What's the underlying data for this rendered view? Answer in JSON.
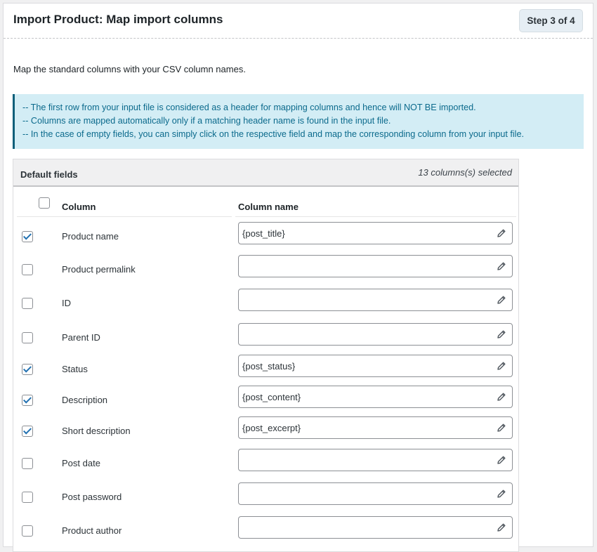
{
  "header": {
    "title": "Import Product: Map import columns",
    "step": "Step 3 of 4"
  },
  "intro": "Map the standard columns with your CSV column names.",
  "notice": {
    "lines": [
      "-- The first row from your input file is considered as a header for mapping columns and hence will NOT BE imported.",
      "-- Columns are mapped automatically only if a matching header name is found in the input file.",
      "-- In the case of empty fields, you can simply click on the respective field and map the corresponding column from your input file."
    ]
  },
  "table": {
    "section_label": "Default fields",
    "selected_count": "13 columns(s) selected",
    "columns": {
      "column": "Column",
      "column_name": "Column name"
    },
    "rows": [
      {
        "name": "Product name",
        "checked": true,
        "value": "{post_title}"
      },
      {
        "name": "Product permalink",
        "checked": false,
        "value": ""
      },
      {
        "name": "ID",
        "checked": false,
        "value": ""
      },
      {
        "name": "Parent ID",
        "checked": false,
        "value": ""
      },
      {
        "name": "Status",
        "checked": true,
        "value": "{post_status}"
      },
      {
        "name": "Description",
        "checked": true,
        "value": "{post_content}"
      },
      {
        "name": "Short description",
        "checked": true,
        "value": "{post_excerpt}"
      },
      {
        "name": "Post date",
        "checked": false,
        "value": ""
      },
      {
        "name": "Post password",
        "checked": false,
        "value": ""
      },
      {
        "name": "Product author",
        "checked": false,
        "value": ""
      }
    ]
  },
  "icons": {
    "edit": "pencil-icon"
  },
  "colors": {
    "accent": "#2271b1",
    "notice_bg": "#d3edf5",
    "notice_text": "#0b6a8c",
    "notice_border": "#0b5f7a"
  }
}
